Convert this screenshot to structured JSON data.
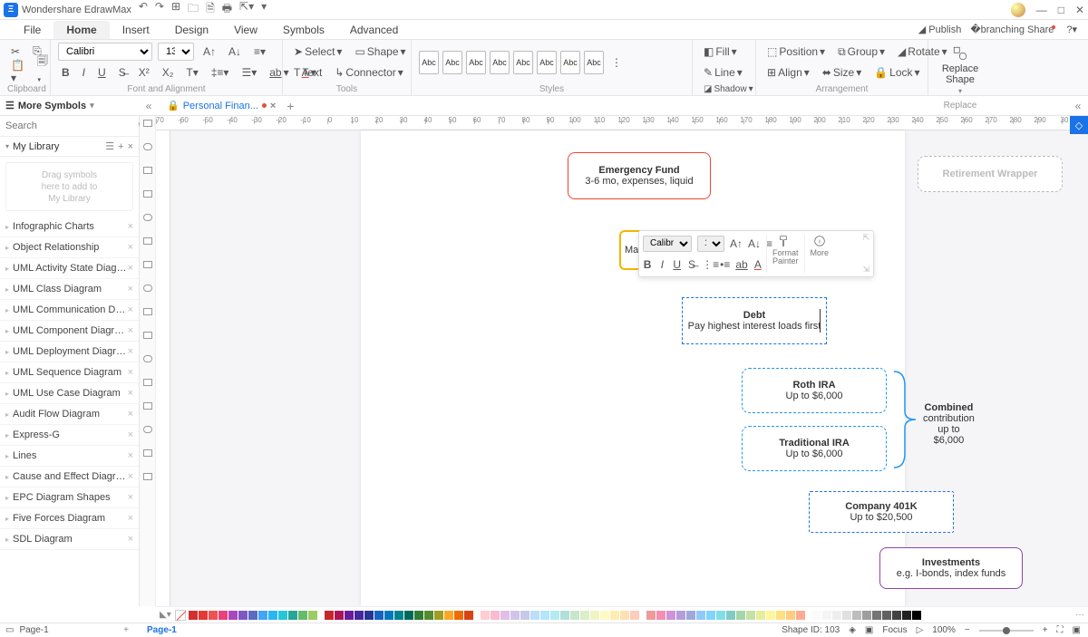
{
  "app": {
    "title": "Wondershare EdrawMax"
  },
  "menu": {
    "items": [
      "File",
      "Home",
      "Insert",
      "Design",
      "View",
      "Symbols",
      "Advanced"
    ],
    "active": "Home",
    "publish": "Publish",
    "share": "Share"
  },
  "ribbon": {
    "clipboard": "Clipboard",
    "font_align": "Font and Alignment",
    "tools": "Tools",
    "styles": "Styles",
    "arrangement": "Arrangement",
    "replace": "Replace",
    "font": "Calibri",
    "size": "13",
    "select": "Select",
    "shape": "Shape",
    "text": "Text",
    "connector": "Connector",
    "abc": "Abc",
    "fill": "Fill",
    "line": "Line",
    "shadow": "Shadow",
    "position": "Position",
    "group": "Group",
    "rotate": "Rotate",
    "align": "Align",
    "sizebtn": "Size",
    "lock": "Lock",
    "replace_shape": "Replace\nShape"
  },
  "subbar": {
    "more_symbols": "More Symbols",
    "tab_name": "Personal Finan..."
  },
  "sidebar": {
    "search_ph": "Search",
    "mylib": "My Library",
    "drop": "Drag symbols\nhere to add to\nMy Library",
    "cats": [
      "Infographic Charts",
      "Object Relationship",
      "UML Activity State Diagram",
      "UML Class Diagram",
      "UML Communication Diagr...",
      "UML Component Diagram",
      "UML Deployment Diagram",
      "UML Sequence Diagram",
      "UML Use Case Diagram",
      "Audit Flow Diagram",
      "Express-G",
      "Lines",
      "Cause and Effect Diagram",
      "EPC Diagram Shapes",
      "Five Forces Diagram",
      "SDL Diagram"
    ]
  },
  "ruler": {
    "vals": [
      "-70",
      "-60",
      "-50",
      "-40",
      "-30",
      "-20",
      "-10",
      "0",
      "10",
      "20",
      "30",
      "40",
      "50",
      "60",
      "70",
      "80",
      "90",
      "100",
      "110",
      "120",
      "130",
      "140",
      "150",
      "160",
      "170",
      "180",
      "190",
      "200",
      "210",
      "220",
      "230",
      "240",
      "250",
      "260",
      "270",
      "280",
      "290",
      "30"
    ]
  },
  "shapes": {
    "emerg": {
      "t": "Emergency Fund",
      "s": "3-6 mo, expenses, liquid"
    },
    "match_prefix": "Ma",
    "debt": {
      "t": "Debt",
      "s": "Pay highest interest loads first"
    },
    "roth": {
      "t": "Roth IRA",
      "s": "Up to $6,000"
    },
    "trad": {
      "t": "Traditional IRA",
      "s": "Up to $6,000"
    },
    "combined": {
      "t": "Combined",
      "s1": "contribution",
      "s2": "up to $6,000"
    },
    "k401": {
      "t": "Company 401K",
      "s": "Up to $20,500"
    },
    "inv": {
      "t": "Investments",
      "s": "e.g. I-bonds, index funds"
    },
    "ret": "Retirement Wrapper"
  },
  "minibar": {
    "font": "Calibri",
    "size": "13",
    "format": "Format",
    "painter": "Painter",
    "more": "More"
  },
  "status": {
    "page": "Page-1",
    "page_tab": "Page-1",
    "shape_id": "Shape ID: 103",
    "focus": "Focus",
    "zoom": "100%"
  },
  "palette_sections": [
    [
      "#d32f2f",
      "#e53935",
      "#ef5350",
      "#ec407a",
      "#ab47bc",
      "#7e57c2",
      "#5c6bc0",
      "#42a5f5",
      "#29b6f6",
      "#26c6da",
      "#26a69a",
      "#66bb6a",
      "#9ccc65"
    ],
    [
      "#c62828",
      "#ad1457",
      "#6a1b9a",
      "#4527a0",
      "#283593",
      "#1565c0",
      "#0277bd",
      "#00838f",
      "#00695c",
      "#2e7d32",
      "#558b2f",
      "#9e9d24",
      "#f9a825",
      "#ef6c00",
      "#d84315"
    ],
    [
      "#ffcdd2",
      "#f8bbd0",
      "#e1bee7",
      "#d1c4e9",
      "#c5cae9",
      "#bbdefb",
      "#b3e5fc",
      "#b2ebf2",
      "#b2dfdb",
      "#c8e6c9",
      "#dcedc8",
      "#f0f4c3",
      "#fff9c4",
      "#ffecb3",
      "#ffe0b2",
      "#ffccbc"
    ],
    [
      "#ef9a9a",
      "#f48fb1",
      "#ce93d8",
      "#b39ddb",
      "#9fa8da",
      "#90caf9",
      "#81d4fa",
      "#80deea",
      "#80cbc4",
      "#a5d6a7",
      "#c5e1a5",
      "#e6ee9c",
      "#fff59d",
      "#ffe082",
      "#ffcc80",
      "#ffab91"
    ],
    [
      "#fafafa",
      "#f5f5f5",
      "#eeeeee",
      "#e0e0e0",
      "#bdbdbd",
      "#9e9e9e",
      "#757575",
      "#616161",
      "#424242",
      "#212121",
      "#000000"
    ]
  ]
}
